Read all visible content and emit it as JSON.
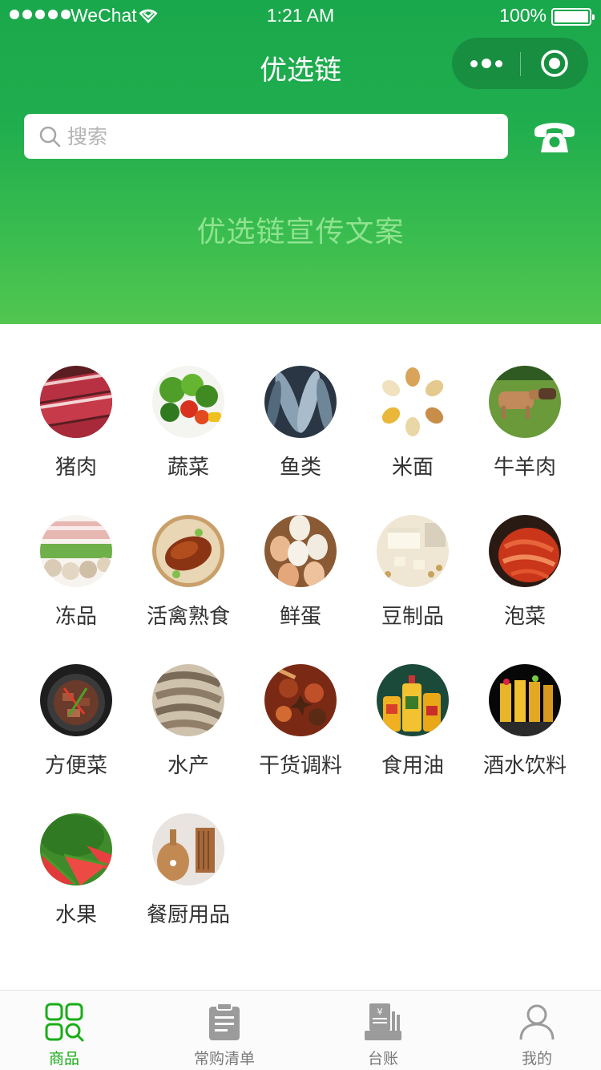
{
  "status_bar": {
    "carrier": "WeChat",
    "time": "1:21 AM",
    "battery": "100%"
  },
  "nav": {
    "title": "优选链"
  },
  "search": {
    "placeholder": "搜索",
    "value": ""
  },
  "promo": {
    "text": "优选链宣传文案"
  },
  "categories": [
    {
      "label": "猪肉",
      "icon": "pork-image"
    },
    {
      "label": "蔬菜",
      "icon": "vegetables-image"
    },
    {
      "label": "鱼类",
      "icon": "fish-image"
    },
    {
      "label": "米面",
      "icon": "grains-image"
    },
    {
      "label": "牛羊肉",
      "icon": "cattle-image"
    },
    {
      "label": "冻品",
      "icon": "frozen-food-image"
    },
    {
      "label": "活禽熟食",
      "icon": "roast-duck-image"
    },
    {
      "label": "鲜蛋",
      "icon": "eggs-image"
    },
    {
      "label": "豆制品",
      "icon": "tofu-image"
    },
    {
      "label": "泡菜",
      "icon": "kimchi-image"
    },
    {
      "label": "方便菜",
      "icon": "prepared-dish-image"
    },
    {
      "label": "水产",
      "icon": "shrimp-image"
    },
    {
      "label": "干货调料",
      "icon": "spices-image"
    },
    {
      "label": "食用油",
      "icon": "cooking-oil-image"
    },
    {
      "label": "酒水饮料",
      "icon": "drinks-image"
    },
    {
      "label": "水果",
      "icon": "watermelon-image"
    },
    {
      "label": "餐厨用品",
      "icon": "kitchenware-image"
    }
  ],
  "tabs": [
    {
      "label": "商品",
      "icon": "grid-search-icon",
      "active": true
    },
    {
      "label": "常购清单",
      "icon": "clipboard-icon",
      "active": false
    },
    {
      "label": "台账",
      "icon": "ledger-icon",
      "active": false
    },
    {
      "label": "我的",
      "icon": "user-icon",
      "active": false
    }
  ],
  "colors": {
    "brand_green": "#1aad19",
    "header_green": "#1fad4e",
    "promo_text": "#8fe38f",
    "tab_inactive": "#7a7a7a"
  }
}
